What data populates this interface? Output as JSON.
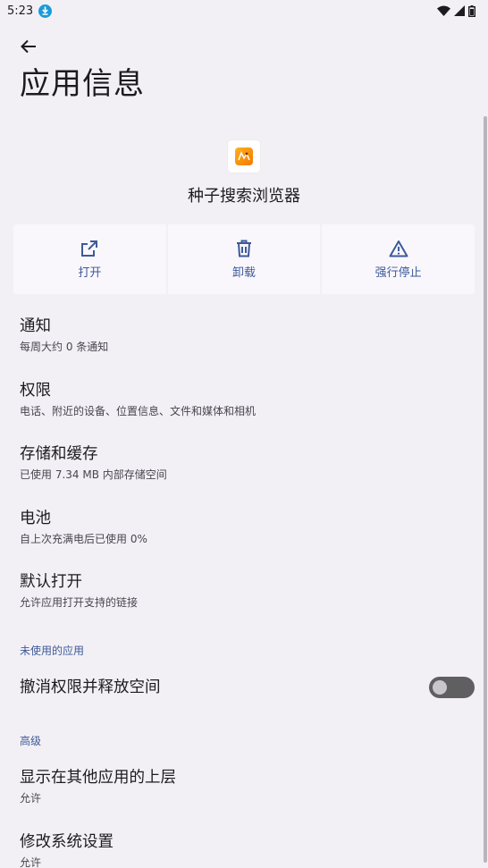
{
  "status_bar": {
    "time": "5:23"
  },
  "header": {
    "title": "应用信息"
  },
  "app": {
    "name": "种子搜索浏览器"
  },
  "actions": [
    {
      "label": "打开",
      "icon": "open-external-icon"
    },
    {
      "label": "卸载",
      "icon": "trash-icon"
    },
    {
      "label": "强行停止",
      "icon": "warning-icon"
    }
  ],
  "items": {
    "notifications": {
      "title": "通知",
      "summary": "每周大约 0 条通知"
    },
    "permissions": {
      "title": "权限",
      "summary": "电话、附近的设备、位置信息、文件和媒体和相机"
    },
    "storage": {
      "title": "存储和缓存",
      "summary": "已使用 7.34 MB 内部存储空间"
    },
    "battery": {
      "title": "电池",
      "summary": "自上次充满电后已使用 0%"
    },
    "open_by_default": {
      "title": "默认打开",
      "summary": "允许应用打开支持的链接"
    },
    "revoke_permissions": {
      "title": "撤消权限并释放空间",
      "enabled": false
    },
    "display_over_apps": {
      "title": "显示在其他应用的上层",
      "summary": "允许"
    },
    "modify_system_settings": {
      "title": "修改系统设置",
      "summary": "允许"
    }
  },
  "sections": {
    "unused_apps": "未使用的应用",
    "advanced": "高级"
  },
  "colors": {
    "accent": "#3d5a99",
    "background": "#f3f0f5",
    "download_badge": "#1a9bd7"
  }
}
